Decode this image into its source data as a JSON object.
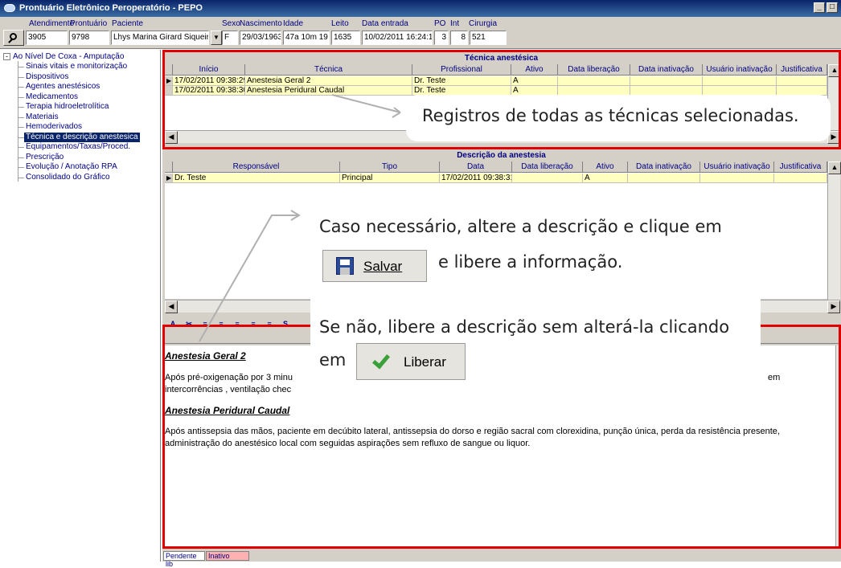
{
  "window": {
    "title": "Prontuário Eletrônico Peroperatório - PEPO",
    "btn_min": "_",
    "btn_max": "□"
  },
  "header": {
    "labels": {
      "atendimento": "Atendimento",
      "prontuario": "Prontuário",
      "paciente": "Paciente",
      "sexo": "Sexo",
      "nascimento": "Nascimento",
      "idade": "Idade",
      "leito": "Leito",
      "data_entrada": "Data entrada",
      "po": "PO",
      "int": "Int",
      "cirurgia": "Cirurgia"
    },
    "values": {
      "atendimento": "3905",
      "prontuario": "9798",
      "paciente": "Lhys Marina Girard Siqueira",
      "sexo": "F",
      "nascimento": "29/03/1963",
      "idade": "47a 10m 19",
      "leito": "1635",
      "data_entrada": "10/02/2011 16:24:15",
      "po": "3",
      "int": "8",
      "cirurgia": "521"
    }
  },
  "tree": {
    "root": "Ao Nível De Coxa - Amputação",
    "root_toggle": "-",
    "items": [
      "Sinais vitais e monitorização",
      "Dispositivos",
      "Agentes anestésicos",
      "Medicamentos",
      "Terapia hidroeletrolítica",
      "Materiais",
      "Hemoderivados",
      "Técnica e descrição anestesica",
      "Equipamentos/Taxas/Proced.",
      "Prescrição",
      "Evolução / Anotação RPA",
      "Consolidado do Gráfico"
    ],
    "selected_index": 7
  },
  "tecnica": {
    "title": "Técnica anestésica",
    "columns": [
      "Início",
      "Técnica",
      "Profissional",
      "Ativo",
      "Data liberação",
      "Data inativação",
      "Usuário inativação",
      "Justificativa"
    ],
    "rows": [
      [
        "17/02/2011 09:38:29",
        "Anestesia Geral 2",
        "Dr. Teste",
        "A",
        "",
        "",
        "",
        ""
      ],
      [
        "17/02/2011 09:38:30",
        "Anestesia Peridural Caudal",
        "Dr. Teste",
        "A",
        "",
        "",
        "",
        ""
      ]
    ]
  },
  "descricao": {
    "title": "Descrição da anestesia",
    "columns": [
      "Responsável",
      "Tipo",
      "Data",
      "Data liberação",
      "Ativo",
      "Data inativação",
      "Usuário inativação",
      "Justificativa"
    ],
    "rows": [
      [
        "Dr. Teste",
        "Principal",
        "17/02/2011 09:38:31",
        "",
        "A",
        "",
        "",
        ""
      ]
    ]
  },
  "editor": {
    "heading1": "Anestesia Geral 2",
    "para1_line1": "Após pré-oxigenação por 3 minu",
    "para1_line1_end": "em",
    "para1_line2": "intercorrências , ventilação chec",
    "heading2": "Anestesia Peridural Caudal",
    "para2": "Após antissepsia das mãos, paciente em decúbito lateral, antissepsia do dorso e região sacral com clorexidina, punção única, perda da resistência presente, administração do anestésico local com seguidas aspirações sem refluxo de sangue ou liquor."
  },
  "toolbar_glyphs": [
    "A",
    "✂",
    "≡",
    "≡",
    "≡",
    "≡",
    "≡",
    "S"
  ],
  "status": {
    "pendente": "Pendente lib",
    "inativo": "Inativo"
  },
  "callouts": {
    "registros": "Registros de todas as técnicas selecionadas.",
    "caso": "Caso necessário, altere a descrição e clique em",
    "libere_info": "e libere a informação.",
    "se_nao": "Se não, libere a descrição sem alterá-la clicando",
    "em": "em",
    "salvar_label": "Salvar",
    "liberar_label": "Liberar"
  },
  "colors": {
    "highlight_red": "#e00000",
    "row_yellow": "#ffffc0",
    "title_blue": "#0a246a",
    "label_navy": "#000080"
  }
}
